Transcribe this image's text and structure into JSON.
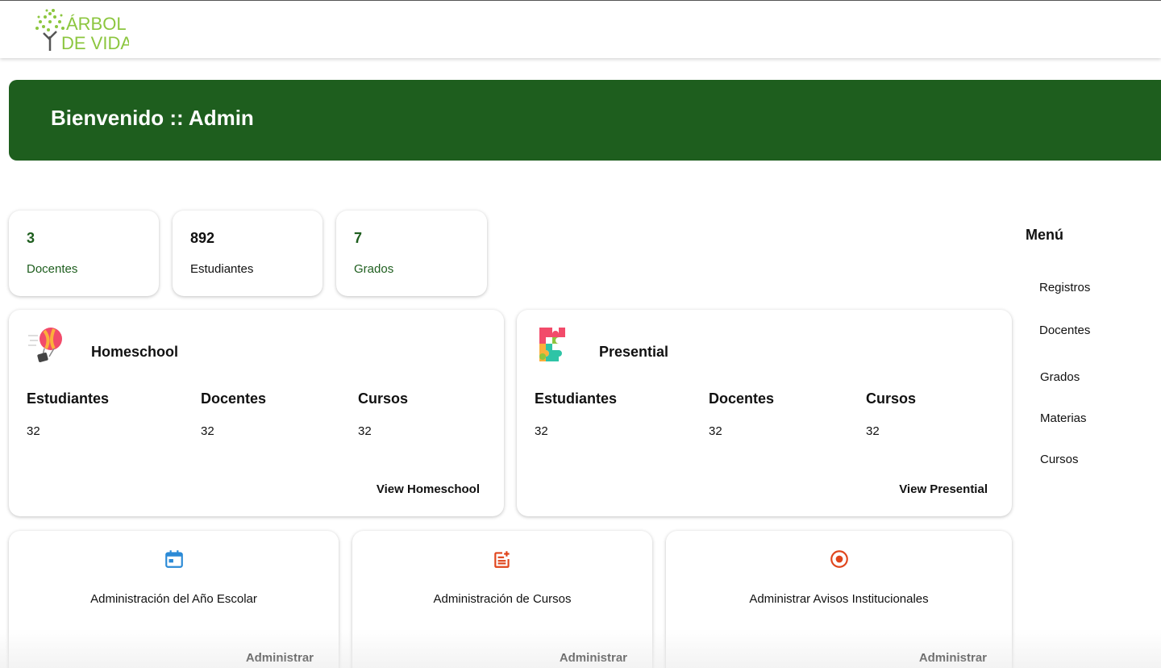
{
  "app": {
    "logo_line1": "ÁRBOL",
    "logo_line2": "DE VIDA",
    "brand_color": "#1e5e1e"
  },
  "banner": {
    "title": "Bienvenido :: Admin"
  },
  "stats": [
    {
      "value": "3",
      "label": "Docentes"
    },
    {
      "value": "892",
      "label": "Estudiantes"
    },
    {
      "value": "7",
      "label": "Grados"
    }
  ],
  "sections": [
    {
      "title": "Homeschool",
      "icon": "hot-air-balloon-icon",
      "columns": [
        {
          "label": "Estudiantes",
          "value": "32"
        },
        {
          "label": "Docentes",
          "value": "32"
        },
        {
          "label": "Cursos",
          "value": "32"
        }
      ],
      "link": "View Homeschool"
    },
    {
      "title": "Presential",
      "icon": "puzzle-icon",
      "columns": [
        {
          "label": "Estudiantes",
          "value": "32"
        },
        {
          "label": "Docentes",
          "value": "32"
        },
        {
          "label": "Cursos",
          "value": "32"
        }
      ],
      "link": "View Presential"
    }
  ],
  "admin_cards": [
    {
      "title": "Administración del Año Escolar",
      "button": "Administrar",
      "icon": "calendar-icon",
      "icon_color": "#2b8ad6"
    },
    {
      "title": "Administración de Cursos",
      "button": "Administrar",
      "icon": "post-add-icon",
      "icon_color": "#e0451c"
    },
    {
      "title": "Administrar Avisos Institucionales",
      "button": "Administrar",
      "icon": "radio-button-icon",
      "icon_color": "#e0451c"
    }
  ],
  "menu": {
    "title": "Menú",
    "items": [
      "Registros",
      "Docentes",
      "Grados",
      "Materias",
      "Cursos"
    ]
  }
}
